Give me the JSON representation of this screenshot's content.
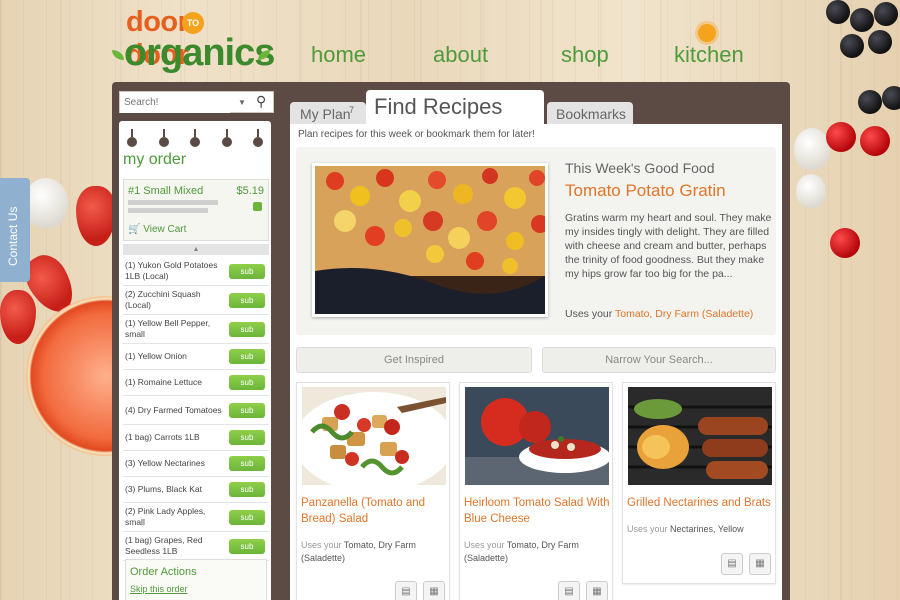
{
  "logo": {
    "top": "door",
    "to": "TO",
    "bottom": "organics"
  },
  "nav": [
    "home",
    "about",
    "shop",
    "kitchen"
  ],
  "search": {
    "placeholder": "Search!"
  },
  "contact_tab": "Contact Us",
  "order": {
    "title": "my order",
    "cart_name": "#1 Small Mixed",
    "cart_price": "$5.19",
    "view_cart": "View Cart",
    "sub_label": "sub",
    "items": [
      "(1) Yukon Gold Potatoes 1LB (Local)",
      "(2) Zucchini Squash (Local)",
      "(1) Yellow Bell Pepper, small",
      "(1) Yellow Onion",
      "(1) Romaine Lettuce",
      "(4) Dry Farmed Tomatoes",
      "(1 bag) Carrots 1LB",
      "(3) Yellow Nectarines",
      "(3) Plums, Black Kat",
      "(2) Pink Lady Apples, small",
      "(1 bag) Grapes, Red Seedless 1LB"
    ],
    "actions_title": "Order Actions",
    "skip_link": "Skip this order"
  },
  "tabs": {
    "my_plan": "My Plan",
    "my_plan_count": "7",
    "find_recipes": "Find Recipes",
    "bookmarks": "Bookmarks"
  },
  "subtitle": "Plan recipes for this week or bookmark them for later!",
  "feature": {
    "tag": "This Week's Good Food",
    "title": "Tomato Potato Gratin",
    "description": "Gratins warm my heart and soul. They make my insides tingly with delight. They are filled with cheese and cream and butter, perhaps the trinity of food goodness. But they make my hips grow far too big for the pa...",
    "uses_prefix": "Uses your",
    "uses": "Tomato, Dry Farm (Saladette)"
  },
  "buttons": {
    "inspired": "Get Inspired",
    "narrow": "Narrow Your Search..."
  },
  "cards": [
    {
      "title": "Panzanella (Tomato and Bread) Salad",
      "uses_prefix": "Uses your",
      "uses": "Tomato, Dry Farm (Saladette)"
    },
    {
      "title": "Heirloom Tomato Salad With Blue Cheese",
      "uses_prefix": "Uses your",
      "uses": "Tomato, Dry Farm (Saladette)"
    },
    {
      "title": "Grilled Nectarines and Brats",
      "uses_prefix": "Uses your",
      "uses": "Nectarines, Yellow"
    }
  ],
  "colors": {
    "brand_green": "#4f9a3a",
    "brand_orange": "#e0762a",
    "panel_brown": "#5b4b44"
  }
}
